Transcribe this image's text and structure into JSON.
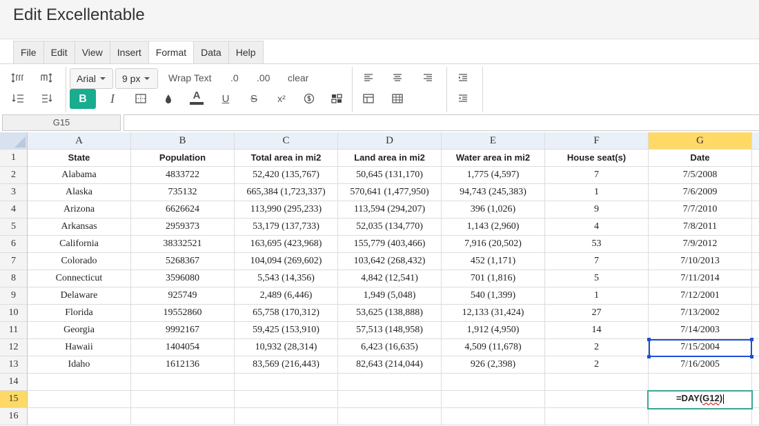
{
  "app": {
    "title": "Edit Excellentable"
  },
  "menu": {
    "tabs": [
      {
        "label": "File"
      },
      {
        "label": "Edit"
      },
      {
        "label": "View"
      },
      {
        "label": "Insert"
      },
      {
        "label": "Format",
        "active": true
      },
      {
        "label": "Data"
      },
      {
        "label": "Help"
      }
    ]
  },
  "toolbar": {
    "font_family": "Arial",
    "font_size": "9 px",
    "wrap_text": "Wrap Text",
    "decrease_decimals": ".0",
    "increase_decimals": ".00",
    "clear": "clear",
    "bold": "B",
    "italic": "I",
    "underline": "U",
    "strikethrough": "S",
    "superscript": "x²",
    "font_color_icon": "A",
    "accent_color": "#1aac8f"
  },
  "formula": {
    "cell_ref": "G15",
    "value": ""
  },
  "sheet": {
    "columns": [
      "A",
      "B",
      "C",
      "D",
      "E",
      "F",
      "G"
    ],
    "selected_column": "G",
    "rows": [
      {
        "num": "1",
        "cells": [
          "State",
          "Population",
          "Total area in mi2",
          "Land area in mi2",
          "Water area in mi2",
          "House seat(s)",
          "Date"
        ]
      },
      {
        "num": "2",
        "cells": [
          "Alabama",
          "4833722",
          "52,420 (135,767)",
          "50,645 (131,170)",
          "1,775 (4,597)",
          "7",
          "7/5/2008"
        ]
      },
      {
        "num": "3",
        "cells": [
          "Alaska",
          "735132",
          "665,384 (1,723,337)",
          "570,641 (1,477,950)",
          "94,743 (245,383)",
          "1",
          "7/6/2009"
        ]
      },
      {
        "num": "4",
        "cells": [
          "Arizona",
          "6626624",
          "113,990 (295,233)",
          "113,594 (294,207)",
          "396 (1,026)",
          "9",
          "7/7/2010"
        ]
      },
      {
        "num": "5",
        "cells": [
          "Arkansas",
          "2959373",
          "53,179 (137,733)",
          "52,035 (134,770)",
          "1,143 (2,960)",
          "4",
          "7/8/2011"
        ]
      },
      {
        "num": "6",
        "cells": [
          "California",
          "38332521",
          "163,695 (423,968)",
          "155,779 (403,466)",
          "7,916 (20,502)",
          "53",
          "7/9/2012"
        ]
      },
      {
        "num": "7",
        "cells": [
          "Colorado",
          "5268367",
          "104,094 (269,602)",
          "103,642 (268,432)",
          "452 (1,171)",
          "7",
          "7/10/2013"
        ]
      },
      {
        "num": "8",
        "cells": [
          "Connecticut",
          "3596080",
          "5,543 (14,356)",
          "4,842 (12,541)",
          "701 (1,816)",
          "5",
          "7/11/2014"
        ]
      },
      {
        "num": "9",
        "cells": [
          "Delaware",
          "925749",
          "2,489 (6,446)",
          "1,949 (5,048)",
          "540 (1,399)",
          "1",
          "7/12/2001"
        ]
      },
      {
        "num": "10",
        "cells": [
          "Florida",
          "19552860",
          "65,758 (170,312)",
          "53,625 (138,888)",
          "12,133 (31,424)",
          "27",
          "7/13/2002"
        ]
      },
      {
        "num": "11",
        "cells": [
          "Georgia",
          "9992167",
          "59,425 (153,910)",
          "57,513 (148,958)",
          "1,912 (4,950)",
          "14",
          "7/14/2003"
        ]
      },
      {
        "num": "12",
        "cells": [
          "Hawaii",
          "1404054",
          "10,932 (28,314)",
          "6,423 (16,635)",
          "4,509 (11,678)",
          "2",
          "7/15/2004"
        ]
      },
      {
        "num": "13",
        "cells": [
          "Idaho",
          "1612136",
          "83,569 (216,443)",
          "82,643 (214,044)",
          "926 (2,398)",
          "2",
          "7/16/2005"
        ]
      },
      {
        "num": "14",
        "cells": [
          "",
          "",
          "",
          "",
          "",
          "",
          ""
        ]
      },
      {
        "num": "15",
        "cells": [
          "",
          "",
          "",
          "",
          "",
          "",
          ""
        ]
      },
      {
        "num": "16",
        "cells": [
          "",
          "",
          "",
          "",
          "",
          "",
          ""
        ]
      }
    ]
  },
  "editing": {
    "cell": "G15",
    "prefix": "=DAY(",
    "ref": "G12",
    "suffix": ")"
  },
  "selection": {
    "range_cell": "G12",
    "selected_row": "15"
  }
}
